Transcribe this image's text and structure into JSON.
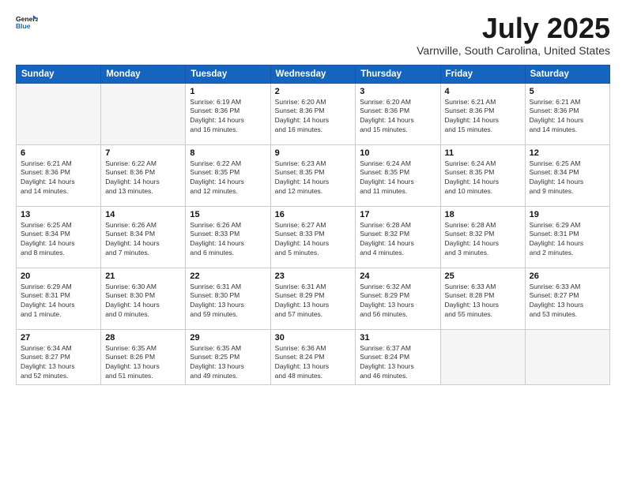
{
  "logo": {
    "line1": "General",
    "line2": "Blue"
  },
  "title": "July 2025",
  "location": "Varnville, South Carolina, United States",
  "weekdays": [
    "Sunday",
    "Monday",
    "Tuesday",
    "Wednesday",
    "Thursday",
    "Friday",
    "Saturday"
  ],
  "weeks": [
    [
      {
        "day": "",
        "info": ""
      },
      {
        "day": "",
        "info": ""
      },
      {
        "day": "1",
        "info": "Sunrise: 6:19 AM\nSunset: 8:36 PM\nDaylight: 14 hours\nand 16 minutes."
      },
      {
        "day": "2",
        "info": "Sunrise: 6:20 AM\nSunset: 8:36 PM\nDaylight: 14 hours\nand 16 minutes."
      },
      {
        "day": "3",
        "info": "Sunrise: 6:20 AM\nSunset: 8:36 PM\nDaylight: 14 hours\nand 15 minutes."
      },
      {
        "day": "4",
        "info": "Sunrise: 6:21 AM\nSunset: 8:36 PM\nDaylight: 14 hours\nand 15 minutes."
      },
      {
        "day": "5",
        "info": "Sunrise: 6:21 AM\nSunset: 8:36 PM\nDaylight: 14 hours\nand 14 minutes."
      }
    ],
    [
      {
        "day": "6",
        "info": "Sunrise: 6:21 AM\nSunset: 8:36 PM\nDaylight: 14 hours\nand 14 minutes."
      },
      {
        "day": "7",
        "info": "Sunrise: 6:22 AM\nSunset: 8:36 PM\nDaylight: 14 hours\nand 13 minutes."
      },
      {
        "day": "8",
        "info": "Sunrise: 6:22 AM\nSunset: 8:35 PM\nDaylight: 14 hours\nand 12 minutes."
      },
      {
        "day": "9",
        "info": "Sunrise: 6:23 AM\nSunset: 8:35 PM\nDaylight: 14 hours\nand 12 minutes."
      },
      {
        "day": "10",
        "info": "Sunrise: 6:24 AM\nSunset: 8:35 PM\nDaylight: 14 hours\nand 11 minutes."
      },
      {
        "day": "11",
        "info": "Sunrise: 6:24 AM\nSunset: 8:35 PM\nDaylight: 14 hours\nand 10 minutes."
      },
      {
        "day": "12",
        "info": "Sunrise: 6:25 AM\nSunset: 8:34 PM\nDaylight: 14 hours\nand 9 minutes."
      }
    ],
    [
      {
        "day": "13",
        "info": "Sunrise: 6:25 AM\nSunset: 8:34 PM\nDaylight: 14 hours\nand 8 minutes."
      },
      {
        "day": "14",
        "info": "Sunrise: 6:26 AM\nSunset: 8:34 PM\nDaylight: 14 hours\nand 7 minutes."
      },
      {
        "day": "15",
        "info": "Sunrise: 6:26 AM\nSunset: 8:33 PM\nDaylight: 14 hours\nand 6 minutes."
      },
      {
        "day": "16",
        "info": "Sunrise: 6:27 AM\nSunset: 8:33 PM\nDaylight: 14 hours\nand 5 minutes."
      },
      {
        "day": "17",
        "info": "Sunrise: 6:28 AM\nSunset: 8:32 PM\nDaylight: 14 hours\nand 4 minutes."
      },
      {
        "day": "18",
        "info": "Sunrise: 6:28 AM\nSunset: 8:32 PM\nDaylight: 14 hours\nand 3 minutes."
      },
      {
        "day": "19",
        "info": "Sunrise: 6:29 AM\nSunset: 8:31 PM\nDaylight: 14 hours\nand 2 minutes."
      }
    ],
    [
      {
        "day": "20",
        "info": "Sunrise: 6:29 AM\nSunset: 8:31 PM\nDaylight: 14 hours\nand 1 minute."
      },
      {
        "day": "21",
        "info": "Sunrise: 6:30 AM\nSunset: 8:30 PM\nDaylight: 14 hours\nand 0 minutes."
      },
      {
        "day": "22",
        "info": "Sunrise: 6:31 AM\nSunset: 8:30 PM\nDaylight: 13 hours\nand 59 minutes."
      },
      {
        "day": "23",
        "info": "Sunrise: 6:31 AM\nSunset: 8:29 PM\nDaylight: 13 hours\nand 57 minutes."
      },
      {
        "day": "24",
        "info": "Sunrise: 6:32 AM\nSunset: 8:29 PM\nDaylight: 13 hours\nand 56 minutes."
      },
      {
        "day": "25",
        "info": "Sunrise: 6:33 AM\nSunset: 8:28 PM\nDaylight: 13 hours\nand 55 minutes."
      },
      {
        "day": "26",
        "info": "Sunrise: 6:33 AM\nSunset: 8:27 PM\nDaylight: 13 hours\nand 53 minutes."
      }
    ],
    [
      {
        "day": "27",
        "info": "Sunrise: 6:34 AM\nSunset: 8:27 PM\nDaylight: 13 hours\nand 52 minutes."
      },
      {
        "day": "28",
        "info": "Sunrise: 6:35 AM\nSunset: 8:26 PM\nDaylight: 13 hours\nand 51 minutes."
      },
      {
        "day": "29",
        "info": "Sunrise: 6:35 AM\nSunset: 8:25 PM\nDaylight: 13 hours\nand 49 minutes."
      },
      {
        "day": "30",
        "info": "Sunrise: 6:36 AM\nSunset: 8:24 PM\nDaylight: 13 hours\nand 48 minutes."
      },
      {
        "day": "31",
        "info": "Sunrise: 6:37 AM\nSunset: 8:24 PM\nDaylight: 13 hours\nand 46 minutes."
      },
      {
        "day": "",
        "info": ""
      },
      {
        "day": "",
        "info": ""
      }
    ]
  ]
}
